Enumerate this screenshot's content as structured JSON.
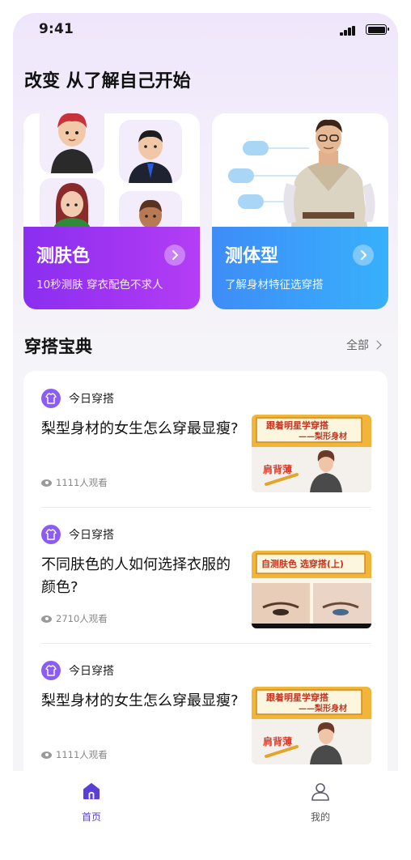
{
  "status_bar": {
    "time": "9:41"
  },
  "headline": "改变 从了解自己开始",
  "feature_cards": [
    {
      "title": "测肤色",
      "subtitle": "10秒测肤 穿衣配色不求人",
      "accent": "#9a32f0"
    },
    {
      "title": "测体型",
      "subtitle": "了解身材特征选穿搭",
      "accent": "#3b96f8"
    }
  ],
  "section": {
    "title": "穿搭宝典",
    "more_label": "全部"
  },
  "articles": [
    {
      "tag": "今日穿搭",
      "title": "梨型身材的女生怎么穿最显瘦?",
      "views": "1111人观看",
      "thumb_line1": "跟着明星学穿搭",
      "thumb_line2": "——梨形身材",
      "thumb_badge": "肩背薄"
    },
    {
      "tag": "今日穿搭",
      "title": "不同肤色的人如何选择衣服的颜色?",
      "views": "2710人观看",
      "thumb_line1": "自测肤色 选穿搭(上)"
    },
    {
      "tag": "今日穿搭",
      "title": "梨型身材的女生怎么穿最显瘦?",
      "views": "1111人观看",
      "thumb_line1": "跟着明星学穿搭",
      "thumb_line2": "——梨形身材",
      "thumb_badge": "肩背薄"
    }
  ],
  "tabbar": {
    "home_label": "首页",
    "me_label": "我的",
    "active_color": "#5a3fd6"
  }
}
